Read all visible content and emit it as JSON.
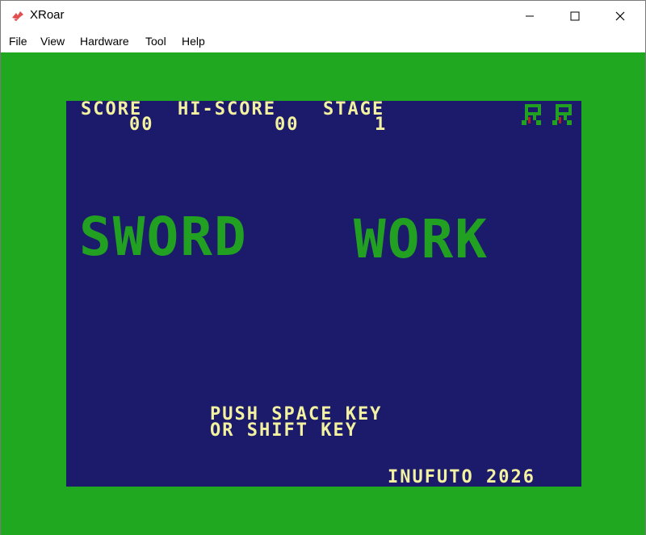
{
  "window": {
    "title": "XRoar",
    "buttons": {
      "minimize": "minimize-icon",
      "maximize": "maximize-icon",
      "close": "close-icon"
    }
  },
  "menu": {
    "items": [
      {
        "label": "File"
      },
      {
        "label": "View"
      },
      {
        "label": "Hardware"
      },
      {
        "label": "Tool"
      },
      {
        "label": "Help"
      }
    ]
  },
  "colors": {
    "border": "#20a820",
    "screen": "#1c1a6a",
    "text": "#f2f2a0",
    "logo": "#22a022",
    "life_icon_green": "#22a022",
    "life_icon_red": "#b02020"
  },
  "hud": {
    "score_label": "SCORE",
    "hiscore_label": "HI-SCORE",
    "stage_label": "STAGE",
    "score_value": "00",
    "hiscore_value": "00",
    "stage_value": "1",
    "lives": 2
  },
  "game": {
    "logo_part1": "SWORD",
    "logo_part2": "WORK",
    "prompt_line1": "PUSH SPACE KEY",
    "prompt_line2": "OR SHIFT KEY",
    "credit": "INUFUTO 2026"
  }
}
